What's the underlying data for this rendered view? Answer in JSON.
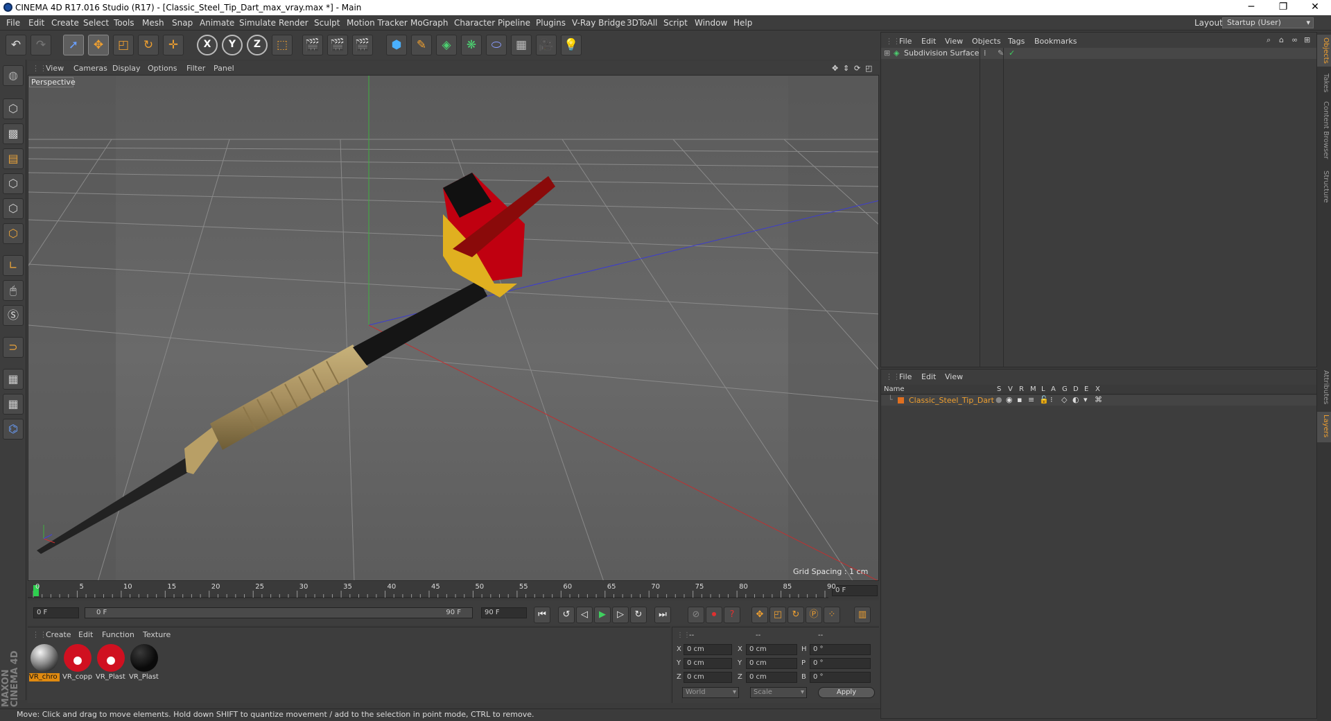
{
  "window": {
    "title": "CINEMA 4D R17.016 Studio (R17) - [Classic_Steel_Tip_Dart_max_vray.max *] - Main",
    "minimize": "─",
    "maximize": "❐",
    "close": "✕"
  },
  "menubar": [
    "File",
    "Edit",
    "Create",
    "Select",
    "Tools",
    "Mesh",
    "Snap",
    "Animate",
    "Simulate",
    "Render",
    "Sculpt",
    "Motion Tracker",
    "MoGraph",
    "Character",
    "Pipeline",
    "Plugins",
    "V-Ray Bridge",
    "3DToAll",
    "Script",
    "Window",
    "Help"
  ],
  "layout": {
    "label": "Layout:",
    "value": "Startup (User)"
  },
  "viewport": {
    "menu": [
      "View",
      "Cameras",
      "Display",
      "Options",
      "Filter",
      "Panel"
    ],
    "camera_label": "Perspective",
    "grid_spacing": "Grid Spacing : 1 cm"
  },
  "timeline": {
    "ticks": [
      "0",
      "5",
      "10",
      "15",
      "20",
      "25",
      "30",
      "35",
      "40",
      "45",
      "50",
      "55",
      "60",
      "65",
      "70",
      "75",
      "80",
      "85",
      "90"
    ],
    "current_frame": "0 F",
    "start_field": "0 F",
    "range_start": "0 F",
    "range_end": "90 F",
    "end_field": "90 F"
  },
  "material_manager": {
    "menu": [
      "Create",
      "Edit",
      "Function",
      "Texture"
    ],
    "materials": [
      {
        "name": "VR_chro",
        "color": "chrome"
      },
      {
        "name": "VR_copp",
        "color": "red-white"
      },
      {
        "name": "VR_Plast",
        "color": "red-white"
      },
      {
        "name": "VR_Plast",
        "color": "black"
      }
    ]
  },
  "coordinates": {
    "header": [
      "--",
      "--",
      "--"
    ],
    "rows": [
      {
        "a": "X",
        "av": "0 cm",
        "b": "X",
        "bv": "0 cm",
        "c": "H",
        "cv": "0 °"
      },
      {
        "a": "Y",
        "av": "0 cm",
        "b": "Y",
        "bv": "0 cm",
        "c": "P",
        "cv": "0 °"
      },
      {
        "a": "Z",
        "av": "0 cm",
        "b": "Z",
        "bv": "0 cm",
        "c": "B",
        "cv": "0 °"
      }
    ],
    "mode": "World",
    "scale": "Scale",
    "apply": "Apply"
  },
  "object_manager": {
    "menu": [
      "File",
      "Edit",
      "View",
      "Objects",
      "Tags",
      "Bookmarks"
    ],
    "objects": [
      {
        "name": "Subdivision Surface"
      }
    ]
  },
  "layer_manager": {
    "menu": [
      "File",
      "Edit",
      "View"
    ],
    "columns": [
      "Name",
      "S",
      "V",
      "R",
      "M",
      "L",
      "A",
      "G",
      "D",
      "E",
      "X"
    ],
    "layers": [
      {
        "name": "Classic_Steel_Tip_Dart",
        "color": "#e07020"
      }
    ]
  },
  "side_tabs": [
    "Objects",
    "Takes",
    "Content Browser",
    "Structure",
    "Attributes",
    "Layers"
  ],
  "status": "Move: Click and drag to move elements. Hold down SHIFT to quantize movement / add to the selection in point mode, CTRL to remove.",
  "brand": "MAXON CINEMA 4D"
}
